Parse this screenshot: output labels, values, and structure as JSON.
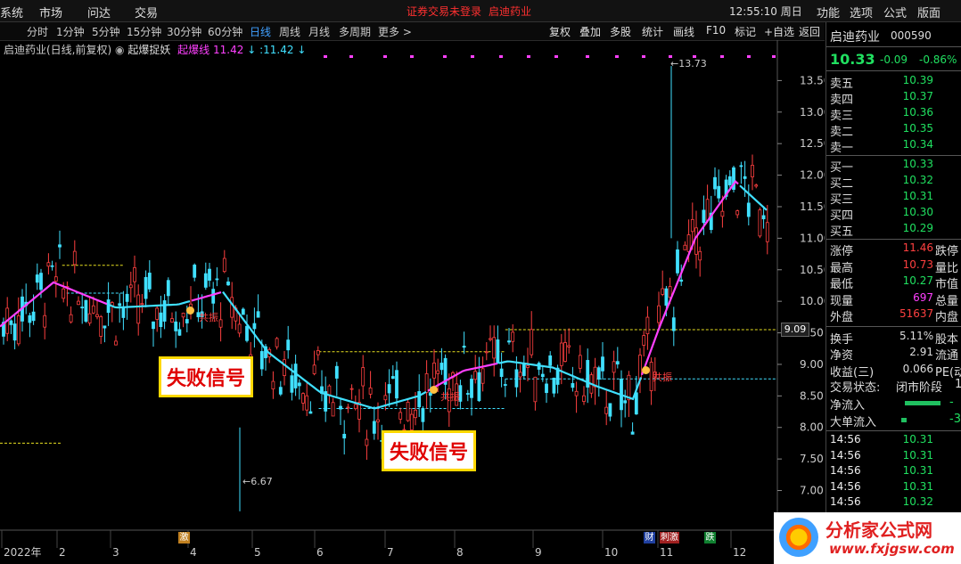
{
  "top_menu": {
    "left": [
      "系统",
      "市场",
      "问达",
      "交易"
    ],
    "notice": "证券交易未登录",
    "stock": "启迪药业",
    "clock": "12:55:10 周日",
    "right": [
      "功能",
      "选项",
      "公式",
      "版面"
    ]
  },
  "periods": [
    "分时",
    "1分钟",
    "5分钟",
    "15分钟",
    "30分钟",
    "60分钟",
    "日线",
    "周线",
    "月线",
    "多周期",
    "更多 >"
  ],
  "active_period": "日线",
  "tools": [
    "复权",
    "叠加",
    "多股",
    "统计",
    "画线",
    "F10",
    "标记",
    "+自选",
    "返回"
  ],
  "indicator": {
    "title": "启迪药业(日线,前复权)",
    "formula": "起爆捉妖",
    "line_name": "起爆线",
    "line_value": "11.42",
    "colon_value": ":11.42"
  },
  "quote": {
    "name": "启迪药业",
    "code": "000590",
    "price": "10.33",
    "change": "-0.09",
    "pct": "-0.86%"
  },
  "asks": [
    {
      "label": "卖五",
      "price": "10.39"
    },
    {
      "label": "卖四",
      "price": "10.37"
    },
    {
      "label": "卖三",
      "price": "10.36"
    },
    {
      "label": "卖二",
      "price": "10.35"
    },
    {
      "label": "卖一",
      "price": "10.34"
    }
  ],
  "bids": [
    {
      "label": "买一",
      "price": "10.33"
    },
    {
      "label": "买二",
      "price": "10.32"
    },
    {
      "label": "买三",
      "price": "10.31"
    },
    {
      "label": "买四",
      "price": "10.30"
    },
    {
      "label": "买五",
      "price": "10.29"
    }
  ],
  "stats1": [
    {
      "label": "涨停",
      "value": "11.46",
      "label2": "跌停",
      "color": "#ff4040"
    },
    {
      "label": "最高",
      "value": "10.73",
      "label2": "量比",
      "color": "#ff4040"
    },
    {
      "label": "最低",
      "value": "10.27",
      "label2": "市值",
      "color": "#20e060"
    },
    {
      "label": "现量",
      "value": "697",
      "label2": "总量",
      "color": "#ff40ff"
    },
    {
      "label": "外盘",
      "value": "51637",
      "label2": "内盘",
      "color": "#ff4040"
    }
  ],
  "stats2": [
    {
      "label": "换手",
      "value": "5.11%",
      "label2": "股本"
    },
    {
      "label": "净资",
      "value": "2.91",
      "label2": "流通"
    },
    {
      "label": "收益(三)",
      "value": "0.066",
      "label2": "PE(动"
    }
  ],
  "status": {
    "label": "交易状态:",
    "value": "闭市阶段",
    "suffix": "1"
  },
  "flows": [
    {
      "label": "净流入",
      "value": "-"
    },
    {
      "label": "大单流入",
      "value": "-3"
    }
  ],
  "ticks": [
    {
      "time": "14:56",
      "price": "10.31"
    },
    {
      "time": "14:56",
      "price": "10.31"
    },
    {
      "time": "14:56",
      "price": "10.31"
    },
    {
      "time": "14:56",
      "price": "10.31"
    },
    {
      "time": "14:56",
      "price": "10.32"
    }
  ],
  "signals": {
    "fail1": "失败信号",
    "fail2": "失败信号",
    "resonance": "共振"
  },
  "chart_labels": {
    "high": "13.73",
    "low": "6.67",
    "last_price": "9.09"
  },
  "events": {
    "e1": "激",
    "e2": "财",
    "e3": "刺激",
    "e4": "跌"
  },
  "logo": {
    "title": "分析家公式网",
    "url": "www.fxjgsw.com"
  },
  "chart_data": {
    "type": "candlestick",
    "y_ticks": [
      13.5,
      13.0,
      12.5,
      12.0,
      11.5,
      11.0,
      10.5,
      10.0,
      9.5,
      9.0,
      8.5,
      8.0,
      7.5,
      7.0
    ],
    "ylim": [
      6.4,
      14.0
    ],
    "x_labels": [
      "2022年",
      "2",
      "3",
      "4",
      "5",
      "6",
      "7",
      "8",
      "9",
      "10",
      "11",
      "12"
    ],
    "high": 13.73,
    "low": 6.67,
    "levels": [
      {
        "name": "yellow-1",
        "value": 10.57,
        "from": 0.08,
        "to": 0.16
      },
      {
        "name": "cyan-1",
        "value": 10.13,
        "from": 0.08,
        "to": 0.16
      },
      {
        "name": "yellow-2",
        "value": 9.2,
        "from": 0.41,
        "to": 0.65
      },
      {
        "name": "cyan-2",
        "value": 8.3,
        "from": 0.41,
        "to": 0.65
      },
      {
        "name": "yellow-3",
        "value": 9.55,
        "from": 0.65,
        "to": 1.0
      },
      {
        "name": "cyan-3",
        "value": 8.77,
        "from": 0.65,
        "to": 1.0
      },
      {
        "name": "yellow-left",
        "value": 7.75,
        "from": 0.0,
        "to": 0.08
      }
    ]
  }
}
